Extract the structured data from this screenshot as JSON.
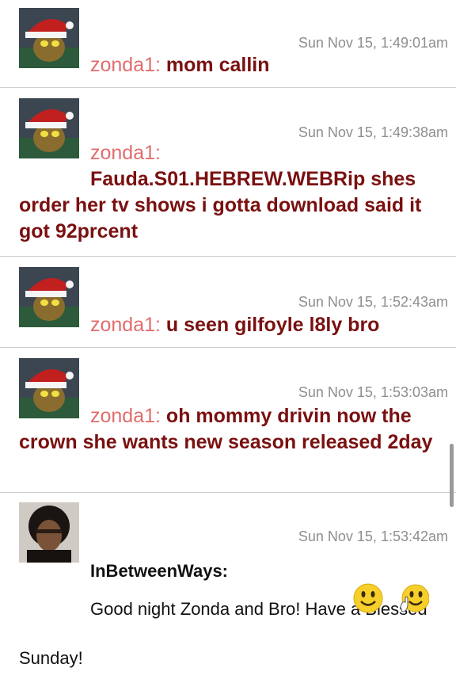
{
  "messages": [
    {
      "user": "zonda1:",
      "time": "Sun Nov 15, 1:49:01am",
      "text": "mom callin"
    },
    {
      "user": "zonda1:",
      "time": "Sun Nov 15, 1:49:38am",
      "text": "Fauda.S01.HEBREW.WEBRip shes order her tv shows i gotta download said it got 92prcent"
    },
    {
      "user": "zonda1:",
      "time": "Sun Nov 15, 1:52:43am",
      "text": "u seen gilfoyle l8ly bro"
    },
    {
      "user": "zonda1:",
      "time": "Sun Nov 15, 1:53:03am",
      "text": "oh mommy drivin now the crown she wants new season released 2day"
    },
    {
      "user": "InBetweenWays:",
      "time": "Sun Nov 15, 1:53:42am",
      "text": "Good night Zonda and Bro! Have a Blessed Sunday!"
    }
  ],
  "colors": {
    "username": "#e26d6d",
    "message": "#7a1010",
    "timestamp": "#8e8e8e",
    "divider": "#cfcfcf"
  },
  "icons": [
    "santa-hat-avatar",
    "portrait-avatar",
    "smiley-icon",
    "waving-smiley-icon"
  ]
}
